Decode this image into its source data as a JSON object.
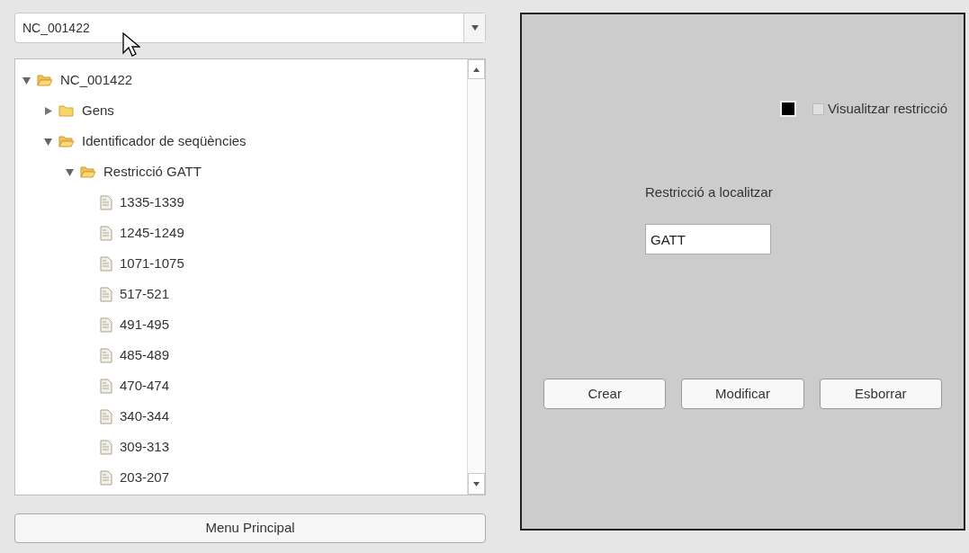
{
  "sequence_select": {
    "value": "NC_001422"
  },
  "tree": [
    {
      "label": "NC_001422",
      "kind": "folder",
      "expanded": true,
      "children": [
        {
          "label": "Gens",
          "kind": "folder",
          "expanded": false
        },
        {
          "label": "Identificador de seqüències",
          "kind": "folder",
          "expanded": true,
          "children": [
            {
              "label": "Restricció GATT",
              "kind": "folder",
              "expanded": true,
              "children": [
                {
                  "label": "1335-1339",
                  "kind": "file"
                },
                {
                  "label": "1245-1249",
                  "kind": "file"
                },
                {
                  "label": "1071-1075",
                  "kind": "file"
                },
                {
                  "label": "517-521",
                  "kind": "file"
                },
                {
                  "label": "491-495",
                  "kind": "file"
                },
                {
                  "label": "485-489",
                  "kind": "file"
                },
                {
                  "label": "470-474",
                  "kind": "file"
                },
                {
                  "label": "340-344",
                  "kind": "file"
                },
                {
                  "label": "309-313",
                  "kind": "file"
                },
                {
                  "label": "203-207",
                  "kind": "file"
                }
              ]
            }
          ]
        }
      ]
    }
  ],
  "menu_button": "Menu Principal",
  "visualize": {
    "label": "Visualitzar restricció",
    "checked": false
  },
  "restriction": {
    "label": "Restricció a localitzar",
    "value": "GATT"
  },
  "buttons": [
    "Crear",
    "Modificar",
    "Esborrar"
  ]
}
